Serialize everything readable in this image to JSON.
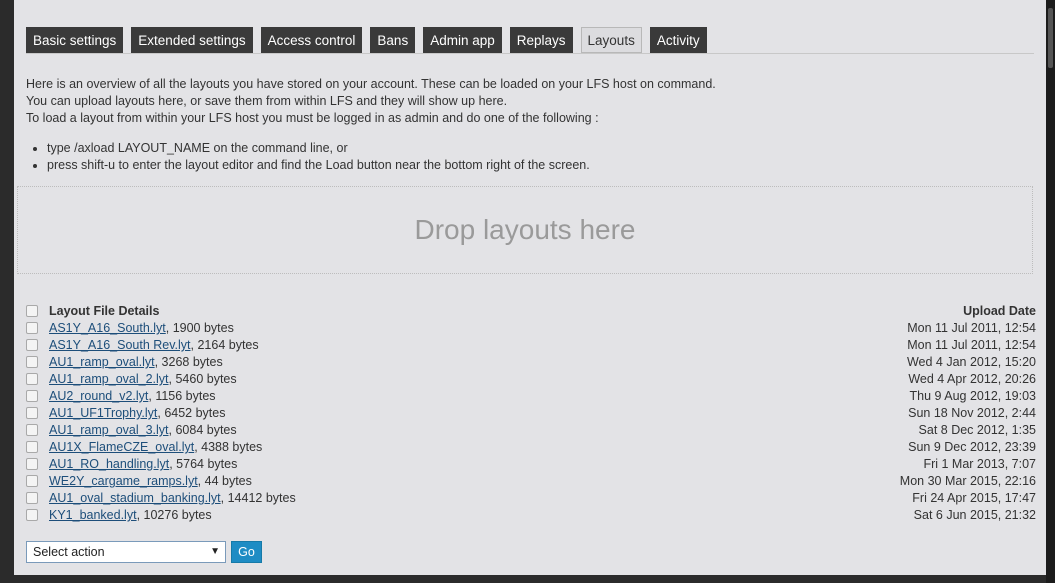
{
  "tabs": [
    {
      "label": "Basic settings"
    },
    {
      "label": "Extended settings"
    },
    {
      "label": "Access control"
    },
    {
      "label": "Bans"
    },
    {
      "label": "Admin app"
    },
    {
      "label": "Replays"
    },
    {
      "label": "Layouts",
      "active": true
    },
    {
      "label": "Activity"
    }
  ],
  "intro": [
    "Here is an overview of all the layouts you have stored on your account. These can be loaded on your LFS host on command.",
    "You can upload layouts here, or save them from within LFS and they will show up here.",
    "To load a layout from within your LFS host you must be logged in as admin and do one of the following :"
  ],
  "instructions": [
    "type /axload LAYOUT_NAME on the command line, or",
    "press shift-u to enter the layout editor and find the Load button near the bottom right of the screen."
  ],
  "dropzone_text": "Drop layouts here",
  "table": {
    "header_file": "Layout File Details",
    "header_date": "Upload Date",
    "rows": [
      {
        "name": "AS1Y_A16_South.lyt",
        "size": ", 1900 bytes",
        "date": "Mon 11 Jul 2011, 12:54"
      },
      {
        "name": "AS1Y_A16_South Rev.lyt",
        "size": ", 2164 bytes",
        "date": "Mon 11 Jul 2011, 12:54"
      },
      {
        "name": "AU1_ramp_oval.lyt",
        "size": ", 3268 bytes",
        "date": "Wed 4 Jan 2012, 15:20"
      },
      {
        "name": "AU1_ramp_oval_2.lyt",
        "size": ", 5460 bytes",
        "date": "Wed 4 Apr 2012, 20:26"
      },
      {
        "name": "AU2_round_v2.lyt",
        "size": ", 1156 bytes",
        "date": "Thu 9 Aug 2012, 19:03"
      },
      {
        "name": "AU1_UF1Trophy.lyt",
        "size": ", 6452 bytes",
        "date": "Sun 18 Nov 2012, 2:44"
      },
      {
        "name": "AU1_ramp_oval_3.lyt",
        "size": ", 6084 bytes",
        "date": "Sat 8 Dec 2012, 1:35"
      },
      {
        "name": "AU1X_FlameCZE_oval.lyt",
        "size": ", 4388 bytes",
        "date": "Sun 9 Dec 2012, 23:39"
      },
      {
        "name": "AU1_RO_handling.lyt",
        "size": ", 5764 bytes",
        "date": "Fri 1 Mar 2013, 7:07"
      },
      {
        "name": "WE2Y_cargame_ramps.lyt",
        "size": ", 44 bytes",
        "date": "Mon 30 Mar 2015, 22:16"
      },
      {
        "name": "AU1_oval_stadium_banking.lyt",
        "size": ", 14412 bytes",
        "date": "Fri 24 Apr 2015, 17:47"
      },
      {
        "name": "KY1_banked.lyt",
        "size": ", 10276 bytes",
        "date": "Sat 6 Jun 2015, 21:32"
      }
    ]
  },
  "action_select": {
    "value": "Select action",
    "arrow": "▼"
  },
  "go_label": "Go"
}
